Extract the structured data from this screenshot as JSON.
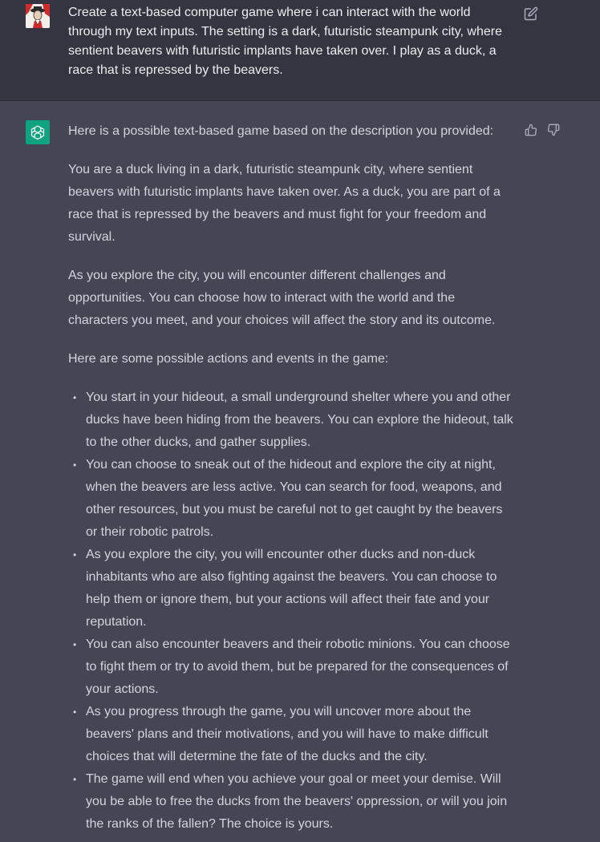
{
  "user_message": {
    "text": "Create a text-based computer game where i can interact with the world through my text inputs. The setting is a dark, futuristic steampunk city, where sentient beavers with futuristic implants have taken over. I play as a duck, a race that is repressed by the beavers.",
    "avatar_icon": "user-avatar-icon",
    "edit_icon": "edit-icon"
  },
  "assistant_message": {
    "avatar_icon": "openai-logo-icon",
    "paragraphs": [
      "Here is a possible text-based game based on the description you provided:",
      "You are a duck living in a dark, futuristic steampunk city, where sentient beavers with futuristic implants have taken over. As a duck, you are part of a race that is repressed by the beavers and must fight for your freedom and survival.",
      "As you explore the city, you will encounter different challenges and opportunities. You can choose how to interact with the world and the characters you meet, and your choices will affect the story and its outcome.",
      "Here are some possible actions and events in the game:"
    ],
    "bullet_glyph": "•",
    "bullets": [
      "You start in your hideout, a small underground shelter where you and other ducks have been hiding from the beavers. You can explore the hideout, talk to the other ducks, and gather supplies.",
      "You can choose to sneak out of the hideout and explore the city at night, when the beavers are less active. You can search for food, weapons, and other resources, but you must be careful not to get caught by the beavers or their robotic patrols.",
      "As you explore the city, you will encounter other ducks and non-duck inhabitants who are also fighting against the beavers. You can choose to help them or ignore them, but your actions will affect their fate and your reputation.",
      "You can also encounter beavers and their robotic minions. You can choose to fight them or try to avoid them, but be prepared for the consequences of your actions.",
      "As you progress through the game, you will uncover more about the beavers' plans and their motivations, and you will have to make difficult choices that will determine the fate of the ducks and the city.",
      "The game will end when you achieve your goal or meet your demise. Will you be able to free the ducks from the beavers' oppression, or will you join the ranks of the fallen? The choice is yours."
    ],
    "feedback_icons": [
      "thumbs-up-icon",
      "thumbs-down-icon"
    ]
  },
  "colors": {
    "user_bg": "#343541",
    "assistant_bg": "#444654",
    "brand_green": "#10a37f",
    "text": "#d1d5db"
  }
}
